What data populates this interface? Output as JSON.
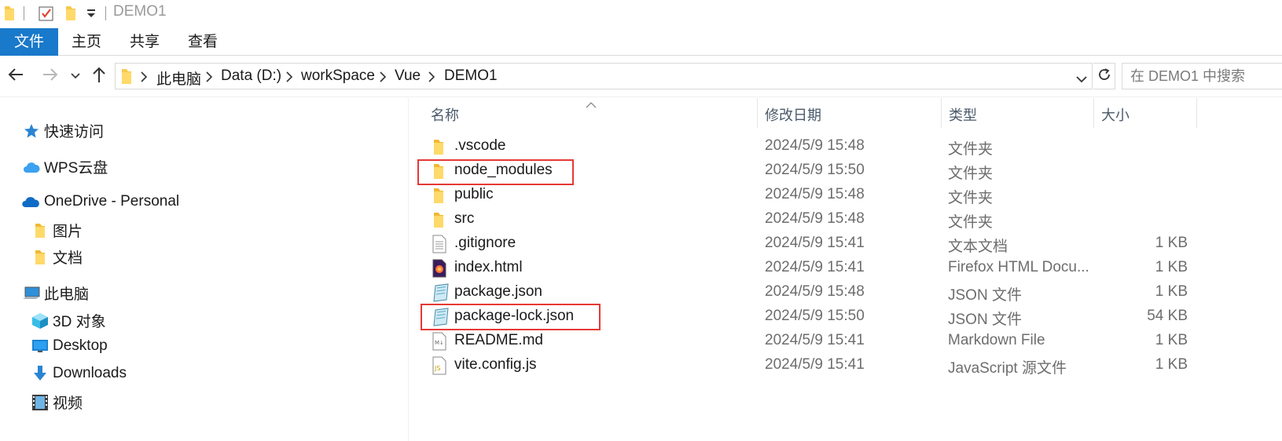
{
  "window": {
    "title": "DEMO1"
  },
  "ribbon": {
    "tabs": [
      {
        "label": "文件",
        "active": true
      },
      {
        "label": "主页",
        "active": false
      },
      {
        "label": "共享",
        "active": false
      },
      {
        "label": "查看",
        "active": false
      }
    ]
  },
  "address": {
    "crumbs": [
      "此电脑",
      "Data (D:)",
      "workSpace",
      "Vue",
      "DEMO1"
    ],
    "search_placeholder": "在 DEMO1 中搜索"
  },
  "navpane": {
    "items": [
      {
        "label": "快速访问",
        "icon": "star-icon"
      },
      {
        "label": "WPS云盘",
        "icon": "cloud-icon"
      },
      {
        "label": "OneDrive - Personal",
        "icon": "onedrive-icon"
      },
      {
        "label": "图片",
        "icon": "folder-icon"
      },
      {
        "label": "文档",
        "icon": "folder-icon"
      },
      {
        "label": "此电脑",
        "icon": "computer-icon"
      },
      {
        "label": "3D 对象",
        "icon": "cube-icon"
      },
      {
        "label": "Desktop",
        "icon": "desktop-icon"
      },
      {
        "label": "Downloads",
        "icon": "download-icon"
      },
      {
        "label": "视频",
        "icon": "video-icon"
      }
    ]
  },
  "columns": {
    "name": "名称",
    "date": "修改日期",
    "type": "类型",
    "size": "大小"
  },
  "files": [
    {
      "name": ".vscode",
      "date": "2024/5/9 15:48",
      "type": "文件夹",
      "size": "",
      "icon": "folder-icon"
    },
    {
      "name": "node_modules",
      "date": "2024/5/9 15:50",
      "type": "文件夹",
      "size": "",
      "icon": "folder-icon",
      "highlighted": true
    },
    {
      "name": "public",
      "date": "2024/5/9 15:48",
      "type": "文件夹",
      "size": "",
      "icon": "folder-icon"
    },
    {
      "name": "src",
      "date": "2024/5/9 15:48",
      "type": "文件夹",
      "size": "",
      "icon": "folder-icon"
    },
    {
      "name": ".gitignore",
      "date": "2024/5/9 15:41",
      "type": "文本文档",
      "size": "1 KB",
      "icon": "text-file-icon"
    },
    {
      "name": "index.html",
      "date": "2024/5/9 15:41",
      "type": "Firefox HTML Docu...",
      "size": "1 KB",
      "icon": "firefox-html-icon"
    },
    {
      "name": "package.json",
      "date": "2024/5/9 15:48",
      "type": "JSON 文件",
      "size": "1 KB",
      "icon": "json-file-icon"
    },
    {
      "name": "package-lock.json",
      "date": "2024/5/9 15:50",
      "type": "JSON 文件",
      "size": "54 KB",
      "icon": "json-file-icon",
      "highlighted": true
    },
    {
      "name": "README.md",
      "date": "2024/5/9 15:41",
      "type": "Markdown File",
      "size": "1 KB",
      "icon": "markdown-file-icon"
    },
    {
      "name": "vite.config.js",
      "date": "2024/5/9 15:41",
      "type": "JavaScript 源文件",
      "size": "1 KB",
      "icon": "js-file-icon"
    }
  ],
  "colors": {
    "accent": "#1979ca",
    "highlight": "#e53935",
    "folder": "#f8c94a"
  }
}
